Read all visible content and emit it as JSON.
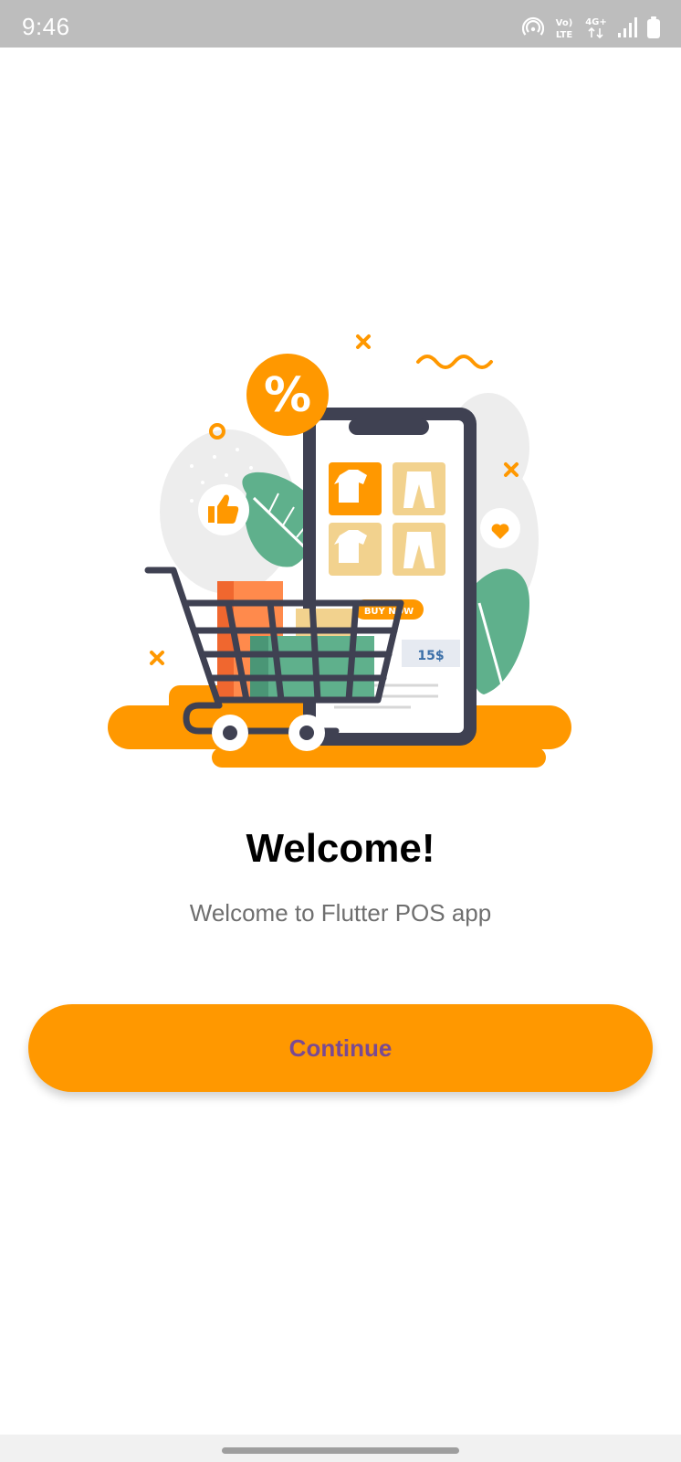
{
  "status_bar": {
    "time": "9:46",
    "icons": [
      "hotspot-icon",
      "volte-icon",
      "4g-icon",
      "signal-icon",
      "battery-icon"
    ],
    "volte_top": "Vo)",
    "volte_bottom": "LTE",
    "network": "4G+"
  },
  "illustration": {
    "discount_badge": "%",
    "buy_now_label": "BUY NOW",
    "price_label": "15$",
    "icons": [
      "percent-badge-icon",
      "thumbs-up-icon",
      "heart-icon",
      "shopping-cart-icon",
      "smartphone-icon",
      "tshirt-icon",
      "pants-icon"
    ]
  },
  "welcome": {
    "title": "Welcome!",
    "subtitle": "Welcome to Flutter POS app"
  },
  "actions": {
    "continue_label": "Continue"
  },
  "colors": {
    "accent": "#ff9800",
    "button_text": "#7a4a92",
    "status_bar": "#bdbdbd",
    "leaf_green": "#5fb08c",
    "phone_dark": "#3f4152"
  }
}
